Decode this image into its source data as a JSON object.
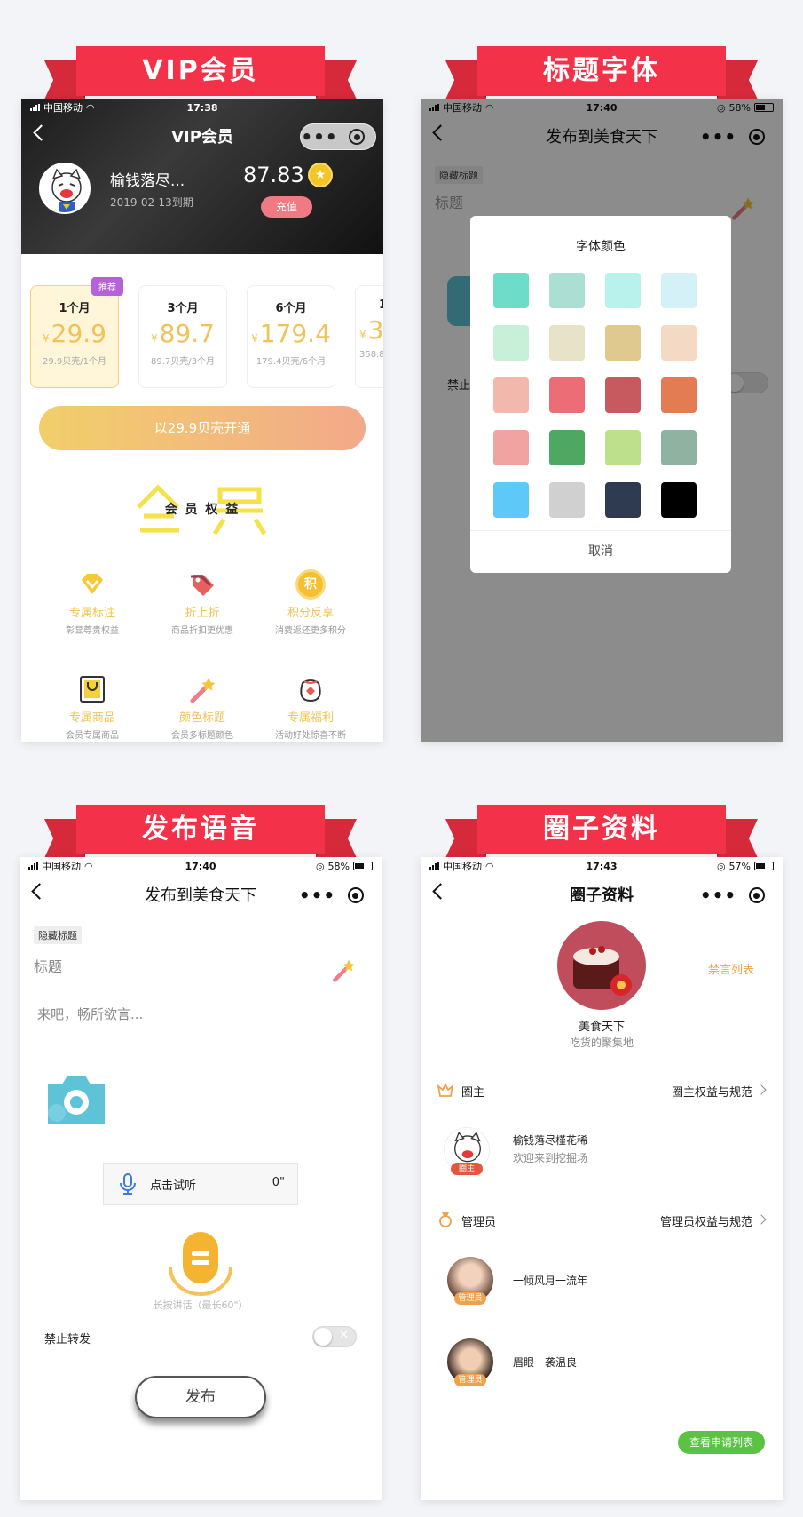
{
  "ribbons": [
    "VIP会员",
    "标题字体",
    "发布语音",
    "圈子资料"
  ],
  "status_bars": [
    {
      "carrier": "中国移动",
      "time": "17:38",
      "battery": ""
    },
    {
      "carrier": "中国移动",
      "time": "17:40",
      "battery": "58%"
    },
    {
      "carrier": "中国移动",
      "time": "17:40",
      "battery": "58%"
    },
    {
      "carrier": "中国移动",
      "time": "17:43",
      "battery": "57%"
    }
  ],
  "vip": {
    "title": "VIP会员",
    "username": "榆钱落尽...",
    "expiry": "2019-02-13到期",
    "balance": "87.83",
    "recharge": "充值",
    "recommend_badge": "推荐",
    "plans": [
      {
        "name": "1个月",
        "price": "29.9",
        "desc": "29.9贝壳/1个月"
      },
      {
        "name": "3个月",
        "price": "89.7",
        "desc": "89.7贝壳/3个月"
      },
      {
        "name": "6个月",
        "price": "179.4",
        "desc": "179.4贝壳/6个月"
      },
      {
        "name": "1",
        "price": "3",
        "desc": "358.8"
      }
    ],
    "currency": "¥",
    "cta": "以29.9贝壳开通",
    "benefits_title": "会 员 权 益",
    "benefits": [
      {
        "title": "专属标注",
        "sub": "彰显尊贵权益",
        "icon": "diamond-icon"
      },
      {
        "title": "折上折",
        "sub": "商品折扣更优惠",
        "icon": "price-tag-icon"
      },
      {
        "title": "积分反享",
        "sub": "消费返还更多积分",
        "icon": "points-coin-icon",
        "glyph": "积"
      },
      {
        "title": "专属商品",
        "sub": "会员专属商品",
        "icon": "shopping-bag-icon"
      },
      {
        "title": "颜色标题",
        "sub": "会员多标题颜色",
        "icon": "magic-wand-icon"
      },
      {
        "title": "专属福利",
        "sub": "活动好处惊喜不断",
        "icon": "gift-bag-icon"
      }
    ]
  },
  "font_color": {
    "nav_title": "发布到美食天下",
    "hidden_title_tag": "隐藏标题",
    "title_placeholder": "标题",
    "forbid_label": "禁止",
    "modal_title": "字体颜色",
    "cancel": "取消",
    "swatches": [
      "#6ddcc8",
      "#abdfd4",
      "#b9f1ec",
      "#d4f1f8",
      "#c8f0d8",
      "#e8e2c8",
      "#e0c98e",
      "#f4d9c4",
      "#f2b8ac",
      "#ec6d75",
      "#c65a5e",
      "#e37c52",
      "#f0a3a1",
      "#4fa862",
      "#bde08d",
      "#8fb3a0",
      "#5ec8f8",
      "#d0d0d0",
      "#2e3b50",
      "#000000"
    ]
  },
  "voice": {
    "nav_title": "发布到美食天下",
    "hidden_title_tag": "隐藏标题",
    "title_placeholder": "标题",
    "content_placeholder": "来吧，畅所欲言...",
    "listen_label": "点击试听",
    "duration": "0\"",
    "hold_hint": "长按讲话（最长60\"）",
    "forbid_forward": "禁止转发",
    "publish": "发布"
  },
  "circle": {
    "nav_title": "圈子资料",
    "name": "美食天下",
    "desc": "吃货的聚集地",
    "ban_list": "禁言列表",
    "owner_section": "圈主",
    "owner_rights": "圈主权益与规范",
    "owner": {
      "name": "榆钱落尽槿花稀",
      "bio": "欢迎来到挖掘场",
      "badge": "圈主"
    },
    "admin_section": "管理员",
    "admin_rights": "管理员权益与规范",
    "admins": [
      {
        "name": "一倾风月一流年",
        "badge": "管理员"
      },
      {
        "name": "眉眼一袭温良",
        "badge": "管理员"
      }
    ],
    "view_applications": "查看申请列表"
  },
  "colors": {
    "ribbon": "#f3324a",
    "gold": "#f1c355",
    "green_button": "#5bc243",
    "orange_link": "#f0a24b"
  }
}
